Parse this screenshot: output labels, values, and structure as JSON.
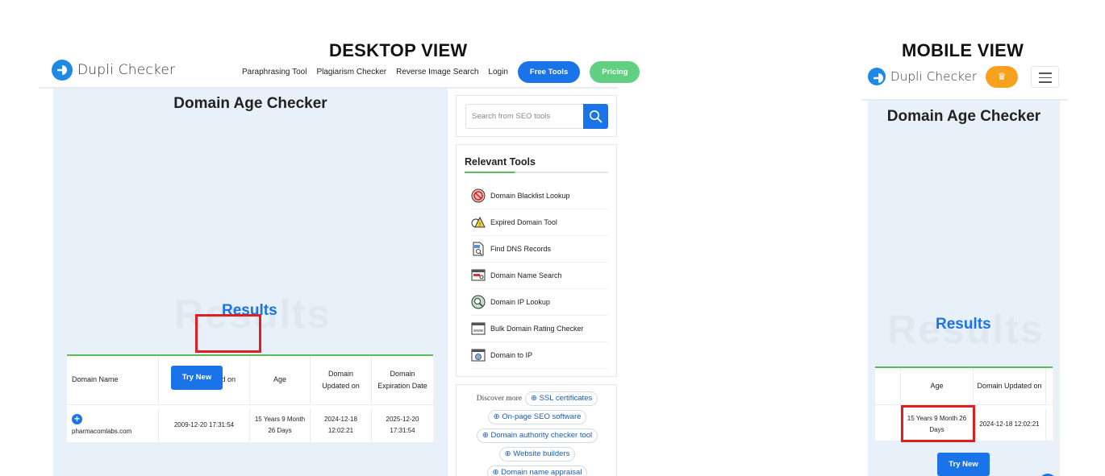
{
  "desktop": {
    "view_label": "DESKTOP VIEW",
    "logo_text": "Dupli Checker",
    "nav": {
      "links": [
        "Paraphrasing Tool",
        "Plagiarism Checker",
        "Reverse Image Search",
        "Login"
      ],
      "free_tools": "Free Tools",
      "pricing": "Pricing"
    },
    "page_title": "Domain Age Checker",
    "results_ghost": "Results",
    "results_title": "Results",
    "table": {
      "headers": [
        "Domain Name",
        "Domain Created on",
        "Age",
        "Domain Updated on",
        "Domain Expiration Date"
      ],
      "row": {
        "domain": "pharmacomlabs.com",
        "created": "2009-12-20 17:31:54",
        "age": "15 Years 9 Month 26 Days",
        "updated": "2024-12-18 12:02:21",
        "expiration": "2025-12-20 17:31:54"
      }
    },
    "try_new": "Try New",
    "search": {
      "placeholder": "Search from SEO tools"
    },
    "relevant_tools": {
      "title": "Relevant Tools",
      "items": [
        {
          "label": "Domain Blacklist Lookup",
          "icon": "blacklist-icon"
        },
        {
          "label": "Expired Domain Tool",
          "icon": "expired-warning-icon"
        },
        {
          "label": "Find DNS Records",
          "icon": "dns-file-icon"
        },
        {
          "label": "Domain Name Search",
          "icon": "domain-search-icon"
        },
        {
          "label": "Domain IP Lookup",
          "icon": "ip-lookup-icon"
        },
        {
          "label": "Bulk Domain Rating Checker",
          "icon": "www-window-icon"
        },
        {
          "label": "Domain to IP",
          "icon": "globe-window-icon"
        }
      ]
    },
    "discover": {
      "label": "Discover more",
      "chips": [
        "SSL certificates",
        "On-page SEO software",
        "Domain authority checker tool",
        "Website builders",
        "Domain name appraisal"
      ]
    }
  },
  "mobile": {
    "view_label": "MOBILE VIEW",
    "logo_text": "Dupli Checker",
    "crown": "♛",
    "page_title": "Domain Age Checker",
    "results_ghost": "Results",
    "results_title": "Results",
    "table": {
      "headers": [
        "Age",
        "Domain Updated on"
      ],
      "row": {
        "age": "15 Years 9 Month 26 Days",
        "updated": "2024-12-18 12:02:21"
      }
    },
    "try_new": "Try New"
  },
  "colors": {
    "accent": "#1a73e8",
    "green": "#5cb85c",
    "highlight": "#e02020",
    "panel": "#e8f0fa",
    "crown": "#f7a11f"
  }
}
